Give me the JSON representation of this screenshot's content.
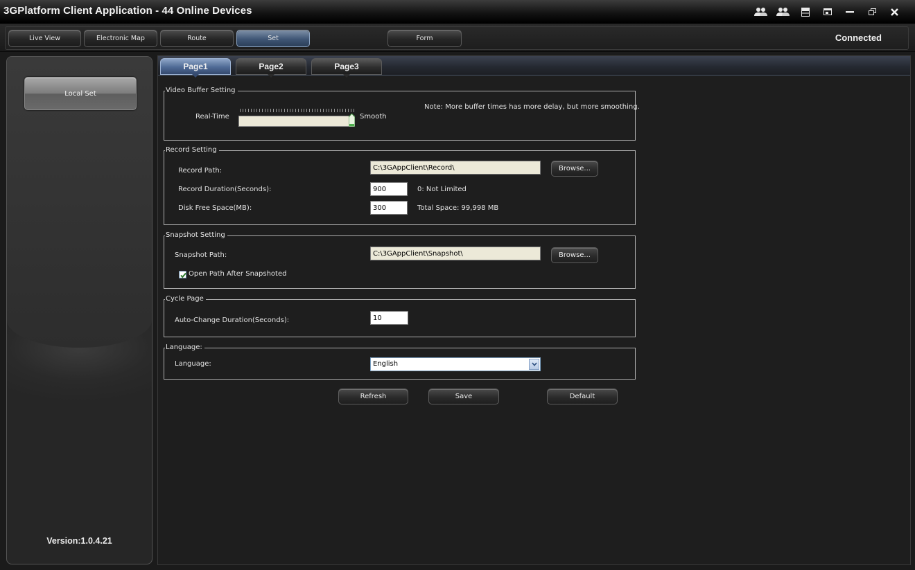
{
  "app": {
    "title": "3GPlatform Client Application - 44 Online Devices",
    "connection_status": "Connected"
  },
  "titlebar_icons": [
    "users-icon",
    "users-online-icon",
    "layout-icon",
    "restore-window-icon",
    "minimize-icon",
    "maximize-icon",
    "close-icon"
  ],
  "nav": {
    "live_view": "Live View",
    "electronic_map": "Electronic Map",
    "route": "Route",
    "set": "Set",
    "form": "Form"
  },
  "sidebar": {
    "local_set": "Local Set",
    "version": "Version:1.0.4.21"
  },
  "tabs": [
    "Page1",
    "Page2",
    "Page3"
  ],
  "video_buffer": {
    "legend": "Video Buffer Setting",
    "left_label": "Real-Time",
    "right_label": "Smooth",
    "note": "Note: More buffer times has more delay, but more smoothing.",
    "level": 1.0
  },
  "record": {
    "legend": "Record Setting",
    "path_label": "Record Path:",
    "path_value": "C:\\3GAppClient\\Record\\",
    "browse": "Browse...",
    "duration_label": "Record Duration(Seconds):",
    "duration_value": "900",
    "duration_hint": "0: Not Limited",
    "disk_label": "Disk Free Space(MB):",
    "disk_value": "300",
    "total_space": "Total Space: 99,998 MB"
  },
  "snapshot": {
    "legend": "Snapshot Setting",
    "path_label": "Snapshot Path:",
    "path_value": "C:\\3GAppClient\\Snapshot\\",
    "browse": "Browse...",
    "open_path_label": "Open Path After Snapshoted",
    "open_path_checked": true
  },
  "cycle": {
    "legend": "Cycle Page",
    "duration_label": "Auto-Change Duration(Seconds):",
    "duration_value": "10"
  },
  "language": {
    "legend": "Language:",
    "label": "Language:",
    "selected": "English"
  },
  "actions": {
    "refresh": "Refresh",
    "save": "Save",
    "default": "Default"
  }
}
